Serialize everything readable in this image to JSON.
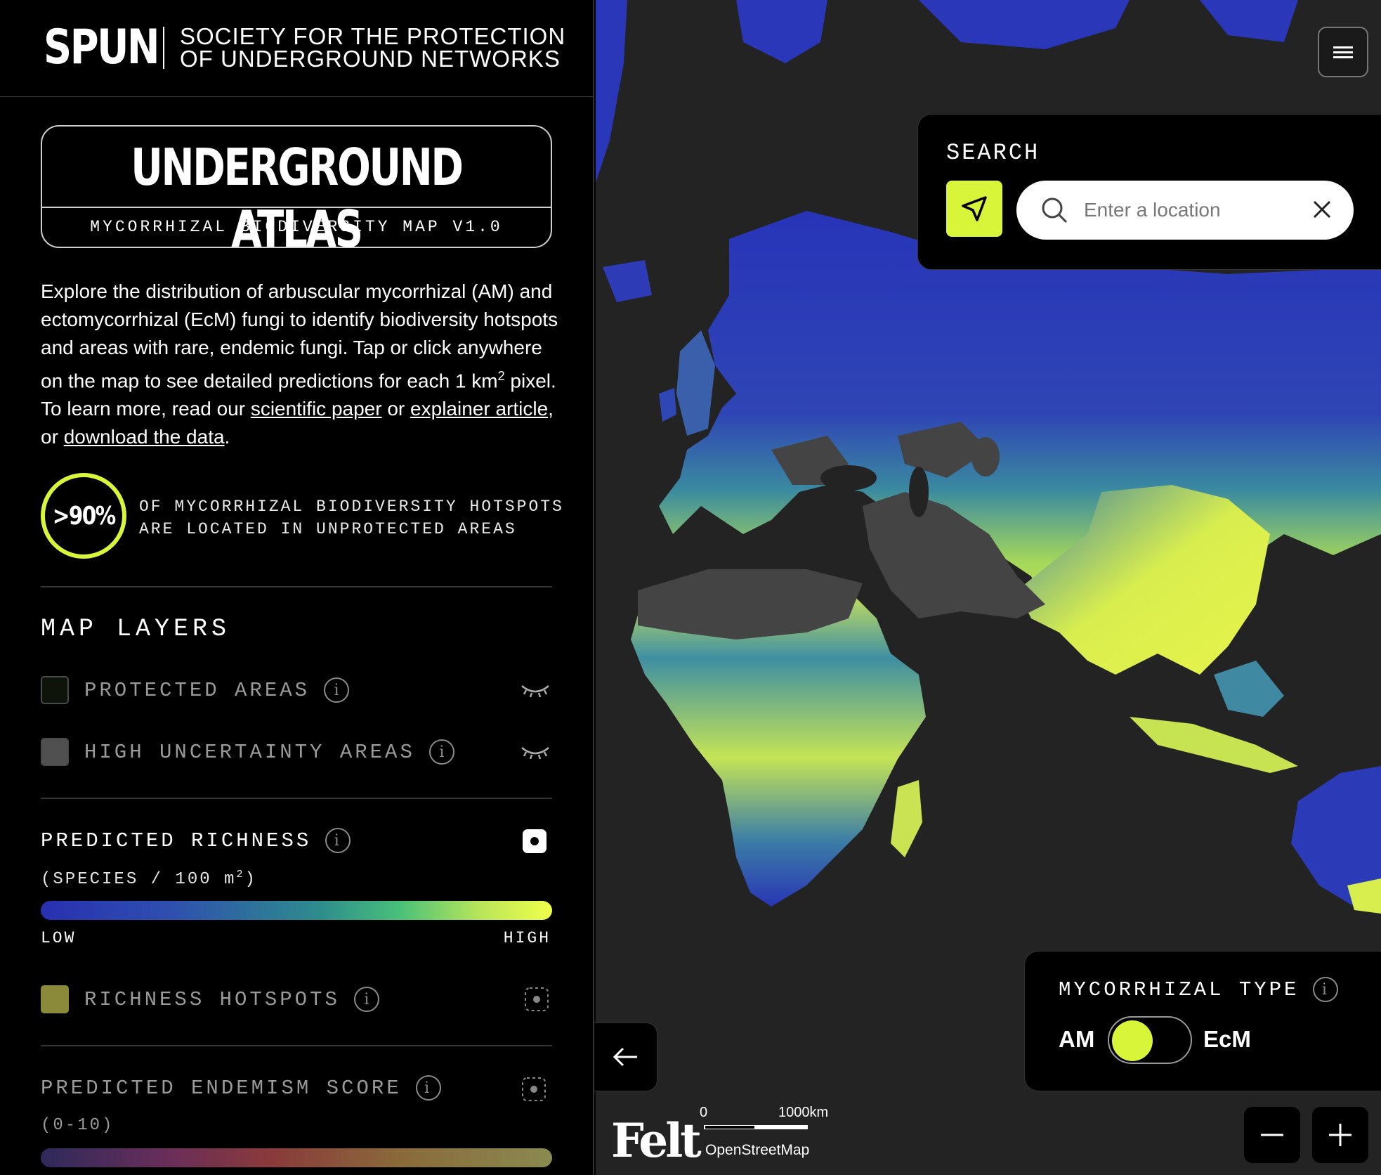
{
  "brand": {
    "logo": "SPUN",
    "society_line1": "SOCIETY FOR THE PROTECTION",
    "society_line2": "OF UNDERGROUND NETWORKS"
  },
  "atlas": {
    "title": "UNDERGROUND ATLAS",
    "subtitle": "MYCORRHIZAL BIODIVERSITY MAP V1.0"
  },
  "intro": {
    "text_1": "Explore the distribution of arbuscular mycorrhizal (AM) and ectomycorrhizal (EcM) fungi to identify biodiversity hotspots and areas with rare, endemic fungi. Tap or click anywhere on the map to see detailed predictions for each 1 km",
    "sup": "2",
    "text_2": " pixel. To learn more, read our ",
    "link_paper": "scientific paper",
    "text_3": " or ",
    "link_explainer": "explainer article",
    "text_4": ", or ",
    "link_download": "download the data",
    "text_5": "."
  },
  "stat": {
    "value": ">90%",
    "line1": "OF MYCORRHIZAL BIODIVERSITY HOTSPOTS",
    "line2": "ARE LOCATED IN UNPROTECTED AREAS"
  },
  "layers": {
    "title": "MAP LAYERS",
    "protected_areas": "PROTECTED AREAS",
    "high_uncertainty": "HIGH UNCERTAINTY AREAS",
    "predicted_richness": "PREDICTED RICHNESS",
    "richness_unit": "(SPECIES / 100 m",
    "richness_unit_sup": "2",
    "richness_unit_end": ")",
    "low": "LOW",
    "high": "HIGH",
    "richness_hotspots": "RICHNESS HOTSPOTS",
    "predicted_endemism": "PREDICTED ENDEMISM SCORE",
    "endemism_unit": "(0-10)"
  },
  "search": {
    "label": "SEARCH",
    "placeholder": "Enter a location"
  },
  "mycorrhizal": {
    "title": "MYCORRHIZAL TYPE",
    "am": "AM",
    "ecm": "EcM",
    "selected": "AM"
  },
  "map": {
    "attribution_logo": "Felt",
    "scale_zero": "0",
    "scale_km": "1000km",
    "osm": "OpenStreetMap"
  },
  "colors": {
    "accent": "#d8f53a",
    "background": "#000000",
    "map_bg": "#232323",
    "land_low": "#2733b5",
    "land_mid": "#3b88a0",
    "land_high": "#e8f34a",
    "desert": "#454545"
  }
}
